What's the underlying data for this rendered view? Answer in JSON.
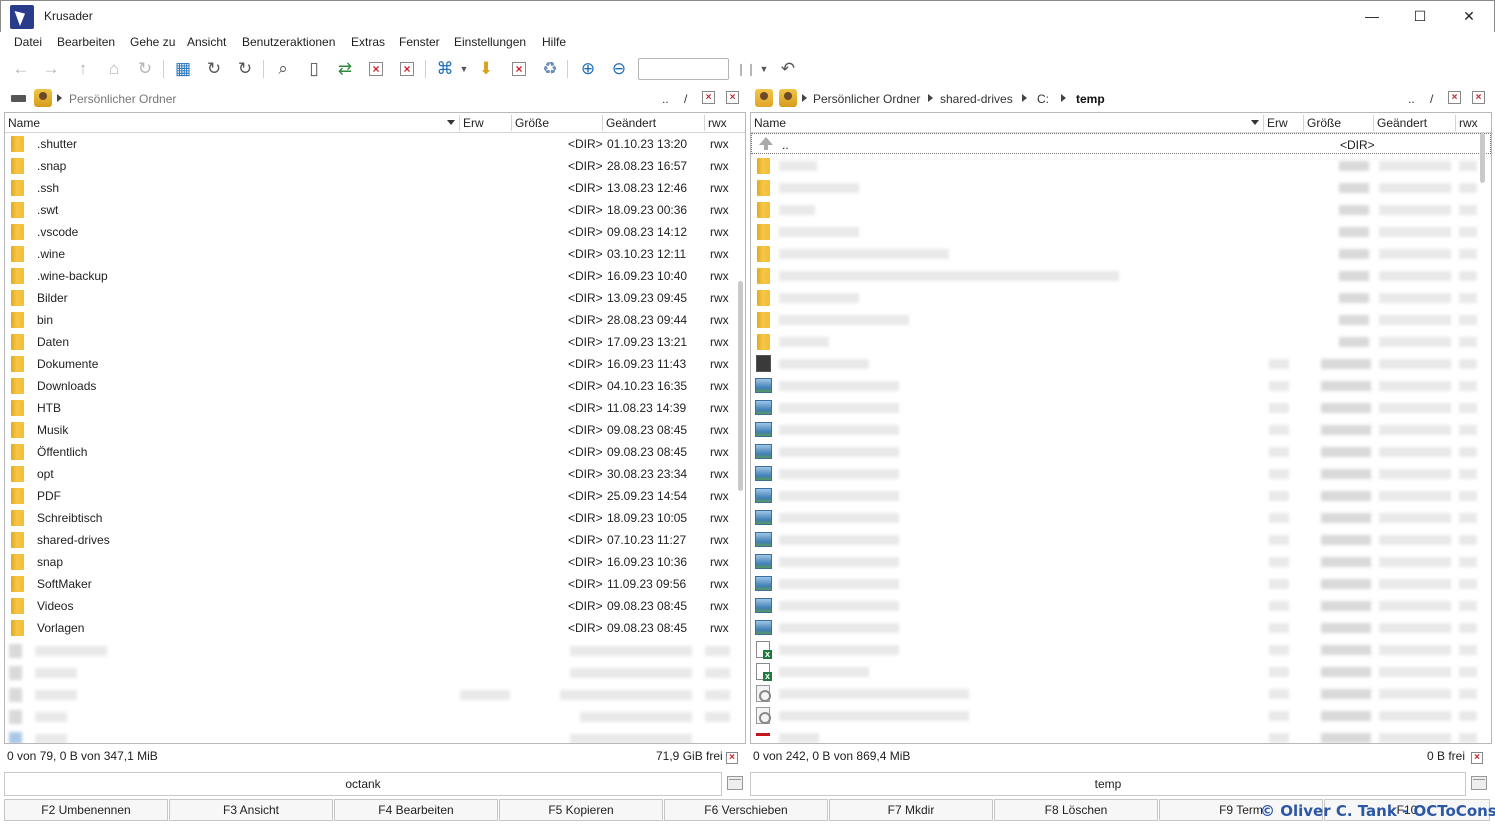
{
  "window": {
    "title": "Krusader",
    "minimize_icon": "—",
    "maximize_icon": "☐",
    "close_icon": "✕"
  },
  "menu": [
    "Datei",
    "Bearbeiten",
    "Gehe zu",
    "Ansicht",
    "Benutzeraktionen",
    "Extras",
    "Fenster",
    "Einstellungen",
    "Hilfe"
  ],
  "left_panel": {
    "path": {
      "home": "Persönlicher Ordner",
      "dotdot": "..",
      "root": "/"
    },
    "columns": {
      "name": "Name",
      "ext": "Erw",
      "size": "Größe",
      "modified": "Geändert",
      "perm": "rwx"
    },
    "rows": [
      {
        "name": ".shutter",
        "size": "<DIR>",
        "modified": "01.10.23 13:20",
        "perm": "rwx"
      },
      {
        "name": ".snap",
        "size": "<DIR>",
        "modified": "28.08.23 16:57",
        "perm": "rwx"
      },
      {
        "name": ".ssh",
        "size": "<DIR>",
        "modified": "13.08.23 12:46",
        "perm": "rwx"
      },
      {
        "name": ".swt",
        "size": "<DIR>",
        "modified": "18.09.23 00:36",
        "perm": "rwx"
      },
      {
        "name": ".vscode",
        "size": "<DIR>",
        "modified": "09.08.23 14:12",
        "perm": "rwx"
      },
      {
        "name": ".wine",
        "size": "<DIR>",
        "modified": "03.10.23 12:11",
        "perm": "rwx"
      },
      {
        "name": ".wine-backup",
        "size": "<DIR>",
        "modified": "16.09.23 10:40",
        "perm": "rwx"
      },
      {
        "name": "Bilder",
        "size": "<DIR>",
        "modified": "13.09.23 09:45",
        "perm": "rwx"
      },
      {
        "name": "bin",
        "size": "<DIR>",
        "modified": "28.08.23 09:44",
        "perm": "rwx"
      },
      {
        "name": "Daten",
        "size": "<DIR>",
        "modified": "17.09.23 13:21",
        "perm": "rwx"
      },
      {
        "name": "Dokumente",
        "size": "<DIR>",
        "modified": "16.09.23 11:43",
        "perm": "rwx"
      },
      {
        "name": "Downloads",
        "size": "<DIR>",
        "modified": "04.10.23 16:35",
        "perm": "rwx"
      },
      {
        "name": "HTB",
        "size": "<DIR>",
        "modified": "11.08.23 14:39",
        "perm": "rwx"
      },
      {
        "name": "Musik",
        "size": "<DIR>",
        "modified": "09.08.23 08:45",
        "perm": "rwx"
      },
      {
        "name": "Öffentlich",
        "size": "<DIR>",
        "modified": "09.08.23 08:45",
        "perm": "rwx"
      },
      {
        "name": "opt",
        "size": "<DIR>",
        "modified": "30.08.23 23:34",
        "perm": "rwx"
      },
      {
        "name": "PDF",
        "size": "<DIR>",
        "modified": "25.09.23 14:54",
        "perm": "rwx"
      },
      {
        "name": "Schreibtisch",
        "size": "<DIR>",
        "modified": "18.09.23 10:05",
        "perm": "rwx"
      },
      {
        "name": "shared-drives",
        "size": "<DIR>",
        "modified": "07.10.23 11:27",
        "perm": "rwx"
      },
      {
        "name": "snap",
        "size": "<DIR>",
        "modified": "16.09.23 10:36",
        "perm": "rwx"
      },
      {
        "name": "SoftMaker",
        "size": "<DIR>",
        "modified": "11.09.23 09:56",
        "perm": "rwx"
      },
      {
        "name": "Videos",
        "size": "<DIR>",
        "modified": "09.08.23 08:45",
        "perm": "rwx"
      },
      {
        "name": "Vorlagen",
        "size": "<DIR>",
        "modified": "09.08.23 08:45",
        "perm": "rwx"
      }
    ],
    "status": "0 von 79, 0 B von 347,1 MiB",
    "free": "71,9 GiB frei",
    "cmdline": "octank"
  },
  "right_panel": {
    "path": {
      "home": "Persönlicher Ordner",
      "seg1": "shared-drives",
      "seg2": "C:",
      "seg3": "temp",
      "dotdot": "..",
      "root": "/"
    },
    "columns": {
      "name": "Name",
      "ext": "Erw",
      "size": "Größe",
      "modified": "Geändert",
      "perm": "rwx"
    },
    "parent_row": {
      "name": "..",
      "size": "<DIR>"
    },
    "status": "0 von 242, 0 B von 869,4 MiB",
    "free": "0 B frei",
    "cmdline": "temp"
  },
  "fkeys": [
    "F2 Umbenennen",
    "F3 Ansicht",
    "F4 Bearbeiten",
    "F5 Kopieren",
    "F6 Verschieben",
    "F7 Mkdir",
    "F8 Löschen",
    "F9 Term",
    "F10"
  ],
  "watermark": "© Oliver C. Tank - OCToConsult"
}
